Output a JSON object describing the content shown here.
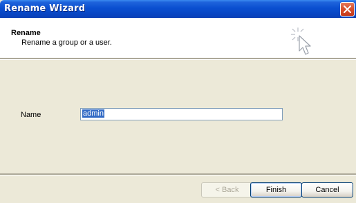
{
  "window": {
    "title": "Rename Wizard"
  },
  "header": {
    "title": "Rename",
    "subtitle": "Rename a group or a user."
  },
  "form": {
    "name_label": "Name",
    "name_value": "admin"
  },
  "buttons": {
    "back": "< Back",
    "finish": "Finish",
    "cancel": "Cancel"
  },
  "icons": {
    "close": "close-icon",
    "wizard": "wizard-cursor-icon"
  },
  "colors": {
    "titlebar": "#0a4fd0",
    "close_button": "#d9512e",
    "selection": "#316ac5",
    "dialog_bg": "#ece9d8"
  }
}
